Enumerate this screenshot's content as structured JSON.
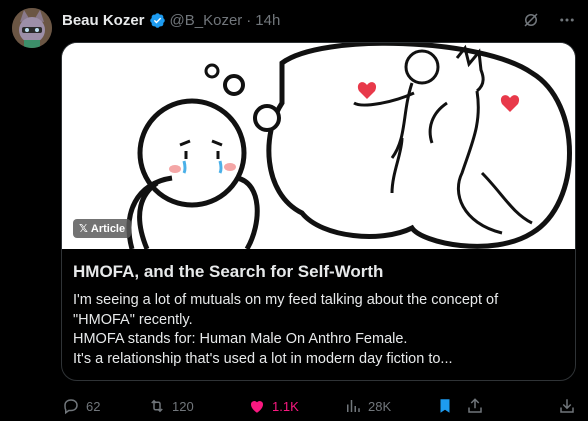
{
  "post": {
    "author_name": "Beau Kozer",
    "handle": "@B_Kozer",
    "separator": "·",
    "time": "14h"
  },
  "card": {
    "badge": "Article",
    "badge_icon": "x-logo-icon",
    "title": "HMOFA, and the Search for Self-Worth",
    "body_lines": [
      "I'm seeing a lot of mutuals on my feed talking about the concept of",
      "\"HMOFA\" recently.",
      "HMOFA stands for: Human Male On Anthro Female.",
      "It's a relationship that's used a lot in modern day fiction to..."
    ]
  },
  "actions": {
    "replies": "62",
    "reposts": "120",
    "likes": "1.1K",
    "views": "28K"
  },
  "colors": {
    "background": "#000000",
    "text": "#e7e9ea",
    "muted": "#71767b",
    "like": "#f91880",
    "verified": "#1d9bf0",
    "bookmark": "#1d9bf0"
  }
}
